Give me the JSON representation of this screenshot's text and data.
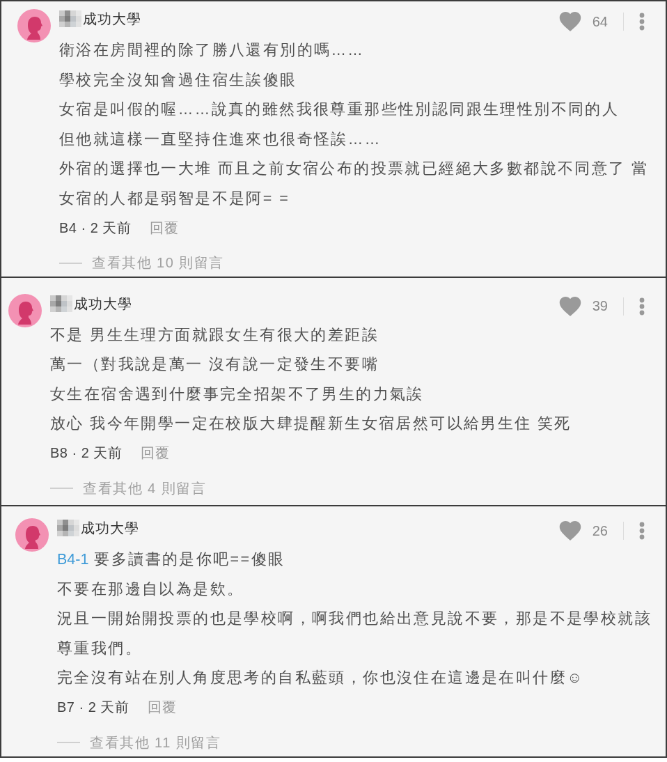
{
  "comments": [
    {
      "author": {
        "name_obscured": true,
        "name": "成功大學"
      },
      "liked": false,
      "likes": "64",
      "lines": [
        {
          "text": "衛浴在房間裡的除了勝八還有別的嗎……"
        },
        {
          "text": "學校完全沒知會過住宿生誒傻眼"
        },
        {
          "text": "女宿是叫假的喔……說真的雖然我很尊重那些性別認同跟生理性別不同的人"
        },
        {
          "text": "但他就這樣一直堅持住進來也很奇怪誒……"
        },
        {
          "text": "外宿的選擇也一大堆 而且之前女宿公布的投票就已經絕大多數都說不同意了 當女宿的人都是弱智是不是阿= ="
        }
      ],
      "floor_time": "B4 · 2 天前",
      "reply": "回覆",
      "more_replies": "查看其他 10 則留言"
    },
    {
      "author": {
        "name_obscured": true,
        "name": "成功大學"
      },
      "liked": false,
      "likes": "39",
      "lines": [
        {
          "text": "不是 男生生理方面就跟女生有很大的差距誒"
        },
        {
          "text": "萬一（對我說是萬一 沒有說一定發生不要嘴"
        },
        {
          "text": "女生在宿舍遇到什麼事完全招架不了男生的力氣誒"
        },
        {
          "text": "放心 我今年開學一定在校版大肆提醒新生女宿居然可以給男生住 笑死"
        }
      ],
      "floor_time": "B8 · 2 天前",
      "reply": "回覆",
      "more_replies": "查看其他 4 則留言"
    },
    {
      "author": {
        "name_obscured": true,
        "name": "成功大學"
      },
      "liked": false,
      "likes": "26",
      "lines": [
        {
          "mention": "B4-1",
          "text": "要多讀書的是你吧==傻眼"
        },
        {
          "text": "不要在那邊自以為是欸。"
        },
        {
          "text": "況且一開始開投票的也是學校啊，啊我們也給出意見說不要，那是不是學校就該尊重我們。"
        },
        {
          "text": "完全沒有站在別人角度思考的自私藍頭，你也沒住在這邊是在叫什麼☺"
        }
      ],
      "floor_time": "B7 · 2 天前",
      "reply": "回覆",
      "more_replies": "查看其他 11 則留言"
    }
  ]
}
